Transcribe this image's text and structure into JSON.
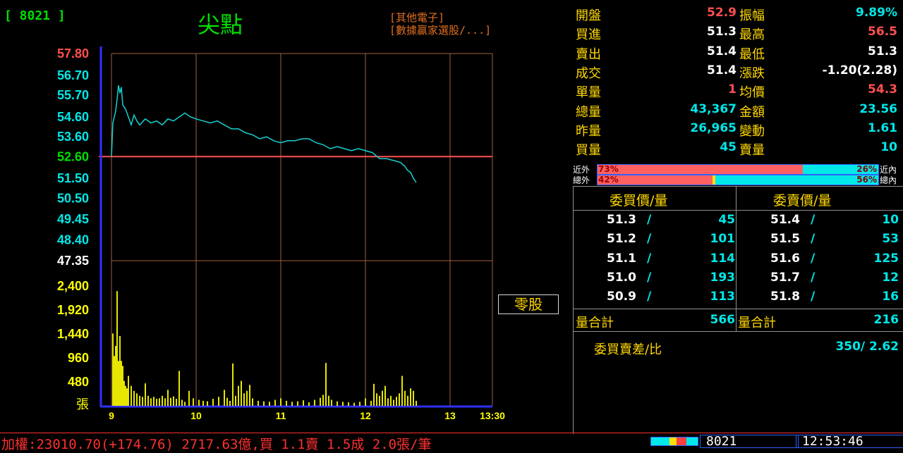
{
  "header": {
    "code": "[ 8021 ]",
    "name": "尖點",
    "category": "[其他電子]",
    "tag": "[數據贏家選股/...]",
    "odd_lot_button": "零股"
  },
  "chart_data": {
    "type": "line",
    "price_axis": {
      "ticks": [
        "57.80",
        "56.70",
        "55.70",
        "54.60",
        "53.60",
        "52.60",
        "51.50",
        "50.50",
        "49.45",
        "48.40",
        "47.35"
      ],
      "ylim": [
        47.35,
        57.8
      ],
      "reference": 52.6
    },
    "volume_axis": {
      "ticks": [
        "2,400",
        "1,920",
        "1,440",
        "960",
        "480"
      ],
      "unit": "張",
      "ylim": [
        0,
        2600
      ]
    },
    "x_ticks": [
      "9",
      "10",
      "11",
      "12",
      "13",
      "13:30"
    ],
    "price_series": [
      [
        0,
        52.6
      ],
      [
        1,
        54.3
      ],
      [
        2,
        54.6
      ],
      [
        3,
        54.9
      ],
      [
        4,
        55.5
      ],
      [
        5,
        56.2
      ],
      [
        6,
        55.8
      ],
      [
        7,
        56.1
      ],
      [
        8,
        55.2
      ],
      [
        10,
        55.0
      ],
      [
        12,
        54.6
      ],
      [
        14,
        54.2
      ],
      [
        16,
        54.7
      ],
      [
        18,
        54.4
      ],
      [
        20,
        54.2
      ],
      [
        24,
        54.5
      ],
      [
        28,
        54.3
      ],
      [
        32,
        54.4
      ],
      [
        36,
        54.2
      ],
      [
        40,
        54.5
      ],
      [
        44,
        54.4
      ],
      [
        48,
        54.6
      ],
      [
        52,
        54.8
      ],
      [
        56,
        54.6
      ],
      [
        60,
        54.5
      ],
      [
        65,
        54.4
      ],
      [
        70,
        54.3
      ],
      [
        75,
        54.4
      ],
      [
        80,
        54.2
      ],
      [
        85,
        54.0
      ],
      [
        90,
        54.0
      ],
      [
        95,
        53.8
      ],
      [
        100,
        53.7
      ],
      [
        105,
        53.5
      ],
      [
        110,
        53.6
      ],
      [
        115,
        53.4
      ],
      [
        120,
        53.3
      ],
      [
        125,
        53.4
      ],
      [
        130,
        53.4
      ],
      [
        135,
        53.5
      ],
      [
        140,
        53.5
      ],
      [
        145,
        53.3
      ],
      [
        150,
        53.2
      ],
      [
        155,
        53.0
      ],
      [
        160,
        53.1
      ],
      [
        165,
        53.0
      ],
      [
        170,
        52.9
      ],
      [
        175,
        53.0
      ],
      [
        180,
        52.9
      ],
      [
        185,
        52.8
      ],
      [
        190,
        52.5
      ],
      [
        195,
        52.5
      ],
      [
        200,
        52.4
      ],
      [
        205,
        52.3
      ],
      [
        208,
        52.1
      ],
      [
        210,
        51.9
      ],
      [
        212,
        51.8
      ],
      [
        214,
        51.5
      ],
      [
        216,
        51.3
      ]
    ],
    "volume_series": [
      [
        1,
        1450
      ],
      [
        2,
        1000
      ],
      [
        3,
        1200
      ],
      [
        4,
        2300
      ],
      [
        5,
        900
      ],
      [
        6,
        1400
      ],
      [
        7,
        900
      ],
      [
        8,
        800
      ],
      [
        9,
        500
      ],
      [
        10,
        400
      ],
      [
        11,
        350
      ],
      [
        12,
        600
      ],
      [
        14,
        400
      ],
      [
        16,
        300
      ],
      [
        18,
        250
      ],
      [
        20,
        200
      ],
      [
        22,
        180
      ],
      [
        24,
        450
      ],
      [
        26,
        200
      ],
      [
        28,
        150
      ],
      [
        30,
        180
      ],
      [
        32,
        140
      ],
      [
        34,
        150
      ],
      [
        36,
        200
      ],
      [
        38,
        150
      ],
      [
        40,
        320
      ],
      [
        42,
        160
      ],
      [
        44,
        190
      ],
      [
        46,
        140
      ],
      [
        48,
        700
      ],
      [
        50,
        120
      ],
      [
        52,
        80
      ],
      [
        55,
        300
      ],
      [
        58,
        150
      ],
      [
        62,
        120
      ],
      [
        65,
        100
      ],
      [
        68,
        90
      ],
      [
        72,
        140
      ],
      [
        76,
        180
      ],
      [
        80,
        320
      ],
      [
        82,
        160
      ],
      [
        84,
        100
      ],
      [
        86,
        850
      ],
      [
        88,
        200
      ],
      [
        90,
        400
      ],
      [
        92,
        500
      ],
      [
        94,
        250
      ],
      [
        96,
        300
      ],
      [
        98,
        420
      ],
      [
        100,
        150
      ],
      [
        104,
        100
      ],
      [
        108,
        90
      ],
      [
        112,
        80
      ],
      [
        116,
        120
      ],
      [
        120,
        150
      ],
      [
        124,
        100
      ],
      [
        128,
        80
      ],
      [
        132,
        90
      ],
      [
        136,
        110
      ],
      [
        140,
        70
      ],
      [
        144,
        120
      ],
      [
        148,
        160
      ],
      [
        150,
        220
      ],
      [
        152,
        860
      ],
      [
        154,
        200
      ],
      [
        156,
        120
      ],
      [
        160,
        90
      ],
      [
        164,
        80
      ],
      [
        168,
        70
      ],
      [
        172,
        60
      ],
      [
        176,
        80
      ],
      [
        180,
        150
      ],
      [
        184,
        100
      ],
      [
        186,
        440
      ],
      [
        188,
        250
      ],
      [
        190,
        200
      ],
      [
        192,
        300
      ],
      [
        194,
        400
      ],
      [
        196,
        150
      ],
      [
        198,
        200
      ],
      [
        200,
        120
      ],
      [
        202,
        180
      ],
      [
        204,
        250
      ],
      [
        206,
        600
      ],
      [
        208,
        300
      ],
      [
        210,
        200
      ],
      [
        212,
        350
      ],
      [
        214,
        300
      ],
      [
        216,
        100
      ]
    ],
    "colors": {
      "price_line": "#18d0d0",
      "volume_bar": "#ffff00",
      "reference_line": "#ff5050",
      "grid": "#a06040",
      "axis": "#3030ff"
    }
  },
  "quote": {
    "rows": [
      {
        "l1": "開盤",
        "v1": "52.9",
        "c1": "red",
        "l2": "振幅",
        "v2": "9.89%",
        "c2": "cyan"
      },
      {
        "l1": "買進",
        "v1": "51.3",
        "c1": "white",
        "l2": "最高",
        "v2": "56.5",
        "c2": "red"
      },
      {
        "l1": "賣出",
        "v1": "51.4",
        "c1": "white",
        "l2": "最低",
        "v2": "51.3",
        "c2": "white"
      },
      {
        "l1": "成交",
        "v1": "51.4",
        "c1": "white",
        "l2": "漲跌",
        "v2": "-1.20(2.28)",
        "c2": "white"
      },
      {
        "l1": "單量",
        "v1": "1",
        "c1": "red",
        "l2": "均價",
        "v2": "54.3",
        "c2": "red"
      },
      {
        "l1": "總量",
        "v1": "43,367",
        "c1": "cyan",
        "l2": "金額",
        "v2": "23.56",
        "c2": "cyan"
      },
      {
        "l1": "昨量",
        "v1": "26,965",
        "c1": "cyan",
        "l2": "變動",
        "v2": "1.61",
        "c2": "cyan"
      },
      {
        "l1": "買量",
        "v1": "45",
        "c1": "cyan",
        "l2": "賣量",
        "v2": "10",
        "c2": "cyan"
      }
    ],
    "ratio_near": {
      "left_label": "近外",
      "right_label": "近內",
      "buy_pct": "73%",
      "sell_pct": "26%",
      "buy": 0.73
    },
    "ratio_total": {
      "left_label": "總外",
      "right_label": "總內",
      "buy_pct": "42%",
      "sell_pct": "56%",
      "buy": 0.42
    }
  },
  "book": {
    "bid_header": "委買價/量",
    "ask_header": "委賣價/量",
    "bids": [
      [
        "51.3",
        "45"
      ],
      [
        "51.2",
        "101"
      ],
      [
        "51.1",
        "114"
      ],
      [
        "51.0",
        "193"
      ],
      [
        "50.9",
        "113"
      ]
    ],
    "asks": [
      [
        "51.4",
        "10"
      ],
      [
        "51.5",
        "53"
      ],
      [
        "51.6",
        "125"
      ],
      [
        "51.7",
        "12"
      ],
      [
        "51.8",
        "16"
      ]
    ],
    "bid_total_label": "量合計",
    "bid_total": "566",
    "ask_total_label": "量合計",
    "ask_total": "216",
    "diff_label": "委買賣差/比",
    "diff_value": "350/ 2.62"
  },
  "ticker": {
    "text": "加權:23010.70(+174.76) 2717.63億,買 1.1賣 1.5成 2.0張/筆",
    "code": "8021",
    "time": "12:53:46"
  }
}
